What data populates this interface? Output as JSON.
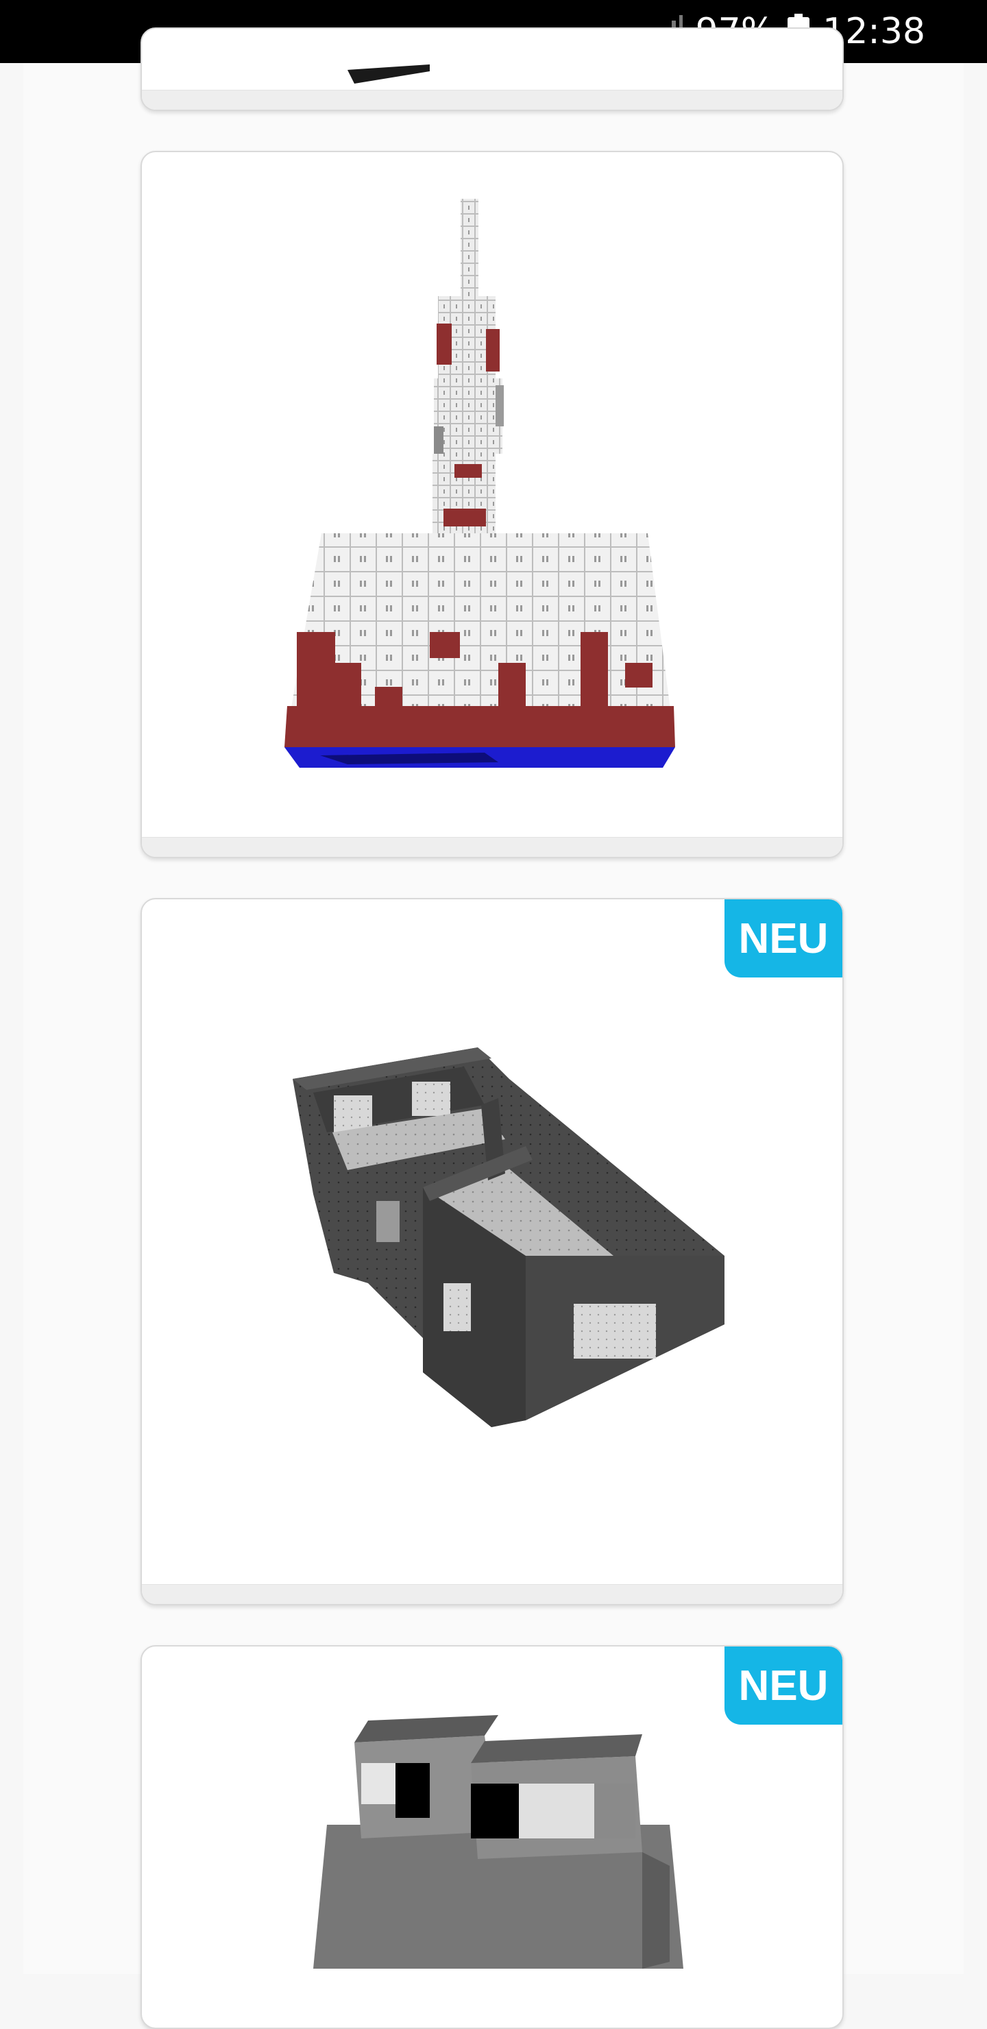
{
  "status_bar": {
    "battery_percent": "97%",
    "time": "12:38",
    "signal_icon": "signal-icon",
    "battery_icon": "battery-icon"
  },
  "cards": [
    {
      "id": "card-partial-top",
      "badge": null,
      "image_icon": "dark-model-thumbnail"
    },
    {
      "id": "card-tower",
      "badge": null,
      "image_icon": "tower-voxel-model-thumbnail"
    },
    {
      "id": "card-house",
      "badge": "NEU",
      "image_icon": "house-voxel-model-thumbnail"
    },
    {
      "id": "card-creature",
      "badge": "NEU",
      "image_icon": "creature-voxel-model-thumbnail"
    }
  ],
  "colors": {
    "badge": "#15b6e6",
    "status_bar": "#000000",
    "voxel_red": "#8e2f2f",
    "voxel_blue": "#1c1ccf"
  }
}
